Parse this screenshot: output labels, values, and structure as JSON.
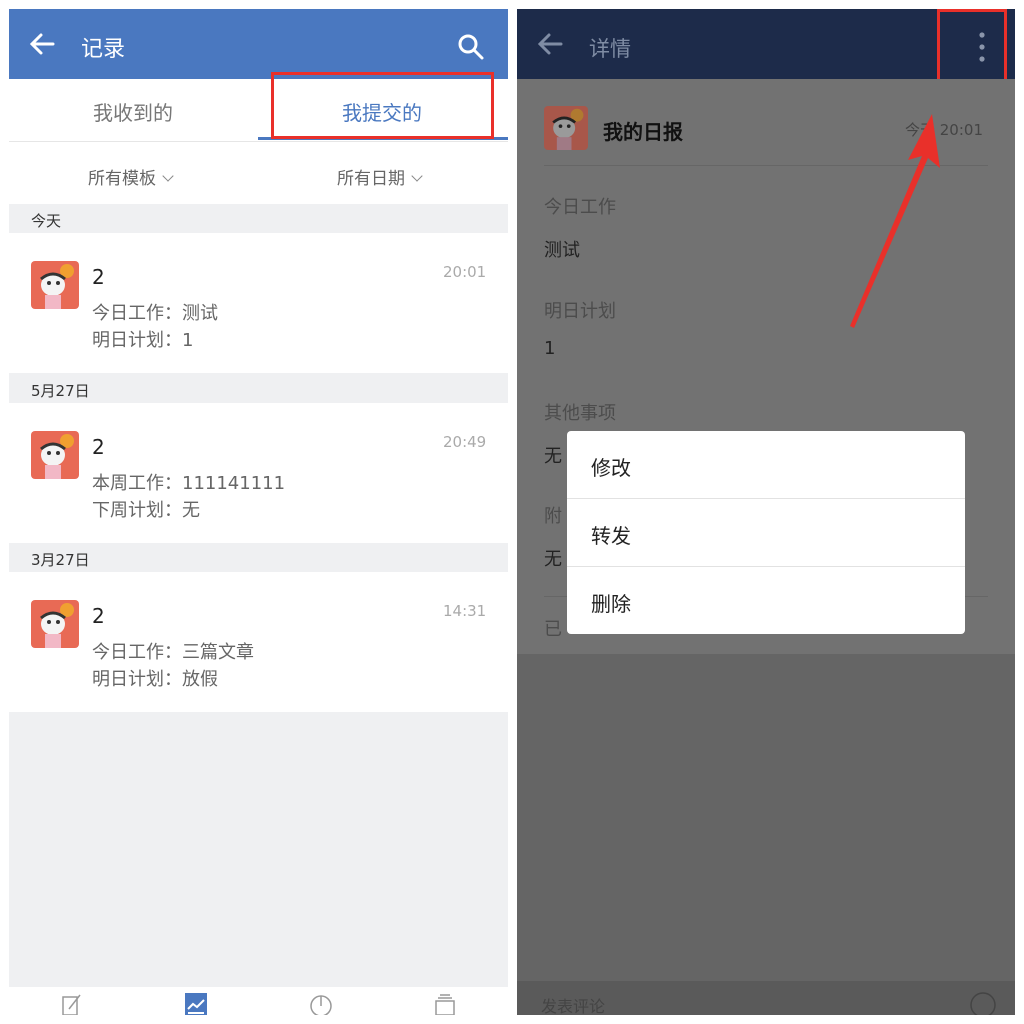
{
  "left": {
    "header": {
      "title": "记录"
    },
    "tabs": [
      {
        "label": "我收到的"
      },
      {
        "label": "我提交的"
      }
    ],
    "filters": [
      {
        "label": "所有模板"
      },
      {
        "label": "所有日期"
      }
    ],
    "groups": [
      {
        "date": "今天",
        "item": {
          "count": "2",
          "time": "20:01",
          "line1": "今日工作：测试",
          "line2": "明日计划：1"
        }
      },
      {
        "date": "5月27日",
        "item": {
          "count": "2",
          "time": "20:49",
          "line1": "本周工作：111141111",
          "line2": "下周计划：无"
        }
      },
      {
        "date": "3月27日",
        "item": {
          "count": "2",
          "time": "14:31",
          "line1": "今日工作：三篇文章",
          "line2": "明日计划：放假"
        }
      }
    ],
    "bottom_nav": [
      "edit-icon",
      "chart-icon",
      "pie-icon",
      "stack-icon"
    ]
  },
  "right": {
    "header": {
      "title": "详情"
    },
    "report": {
      "name": "我的日报",
      "time": "今天 20:01"
    },
    "fields": [
      {
        "label": "今日工作",
        "value": "测试"
      },
      {
        "label": "明日计划",
        "value": "1"
      },
      {
        "label": "其他事项",
        "value": "无"
      },
      {
        "label": "附",
        "value": "无"
      }
    ],
    "footer_partial": "已",
    "menu": [
      {
        "label": "修改"
      },
      {
        "label": "转发"
      },
      {
        "label": "删除"
      }
    ],
    "bottom_text": "发表评论"
  },
  "annotation_color": "#e9302a",
  "primary_color": "#4a78c0"
}
